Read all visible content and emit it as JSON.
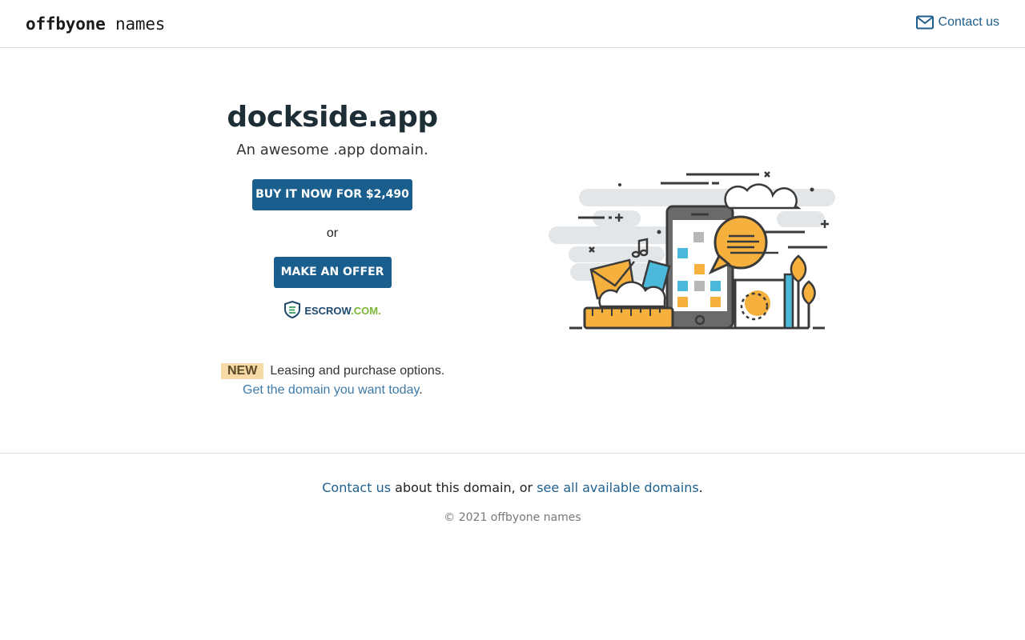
{
  "header": {
    "logo_bold": "offbyone",
    "logo_light": "names",
    "contact_label": "Contact us"
  },
  "main": {
    "domain": "dockside.app",
    "tagline": "An awesome .app domain.",
    "buy_button": "BUY IT NOW FOR $2,490",
    "or_text": "or",
    "offer_button": "MAKE AN OFFER",
    "escrow_part1": "ESCROW",
    "escrow_part2": ".COM."
  },
  "promo": {
    "badge": "NEW",
    "description": "Leasing and purchase options.",
    "link_text": "Get the domain you want today",
    "link_suffix": "."
  },
  "footer": {
    "contact_link": "Contact us",
    "middle_text": " about this domain, or ",
    "domains_link": "see all available domains",
    "end_text": ".",
    "copyright": "© 2021 offbyone names"
  },
  "colors": {
    "brand_blue": "#1a5e8e",
    "link_blue": "#1e5f8e",
    "badge_bg": "#f7d9a6",
    "illustration_yellow": "#f5b03e",
    "illustration_cyan": "#4bb9d9"
  }
}
